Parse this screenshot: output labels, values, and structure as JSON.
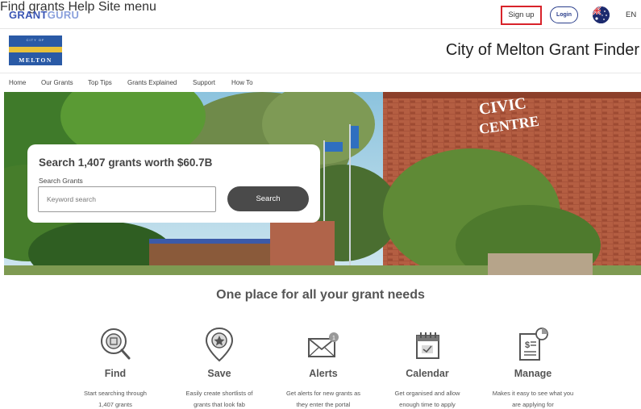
{
  "brand": {
    "part1": "GRANT",
    "part2": "GURU"
  },
  "topnav": {
    "find_grants": "Find grants",
    "help": "Help",
    "site_menu": "Site menu",
    "sign_up": "Sign up",
    "login": "Login",
    "language": "EN"
  },
  "header": {
    "logo_text": "MELTON",
    "logo_subtext": "CITY OF",
    "title": "City of Melton Grant Finder"
  },
  "subnav": [
    "Home",
    "Our Grants",
    "Top Tips",
    "Grants Explained",
    "Support",
    "How To"
  ],
  "hero": {
    "search_title": "Search 1,407 grants worth $60.7B",
    "search_label": "Search Grants",
    "search_placeholder": "Keyword search",
    "search_button": "Search",
    "sign_text": "CIVIC\nCENTRE"
  },
  "features": {
    "tagline": "One place for all your grant needs",
    "items": [
      {
        "icon": "magnifier-icon",
        "title": "Find",
        "line1": "Start searching through",
        "line2": "1,407 grants"
      },
      {
        "icon": "location-pin-icon",
        "title": "Save",
        "line1": "Easily create shortlists of",
        "line2": "grants that look fab"
      },
      {
        "icon": "envelope-icon",
        "title": "Alerts",
        "line1": "Get alerts for new grants as",
        "line2": "they enter the portal"
      },
      {
        "icon": "calendar-icon",
        "title": "Calendar",
        "line1": "Get organised and allow",
        "line2": "enough time to apply"
      },
      {
        "icon": "document-chart-icon",
        "title": "Manage",
        "line1": "Makes it easy to see what you",
        "line2": "are applying for"
      }
    ]
  },
  "colors": {
    "brand_blue": "#3a55b4",
    "signup_highlight": "#d8232a",
    "button_dark": "#4a4a4a"
  }
}
